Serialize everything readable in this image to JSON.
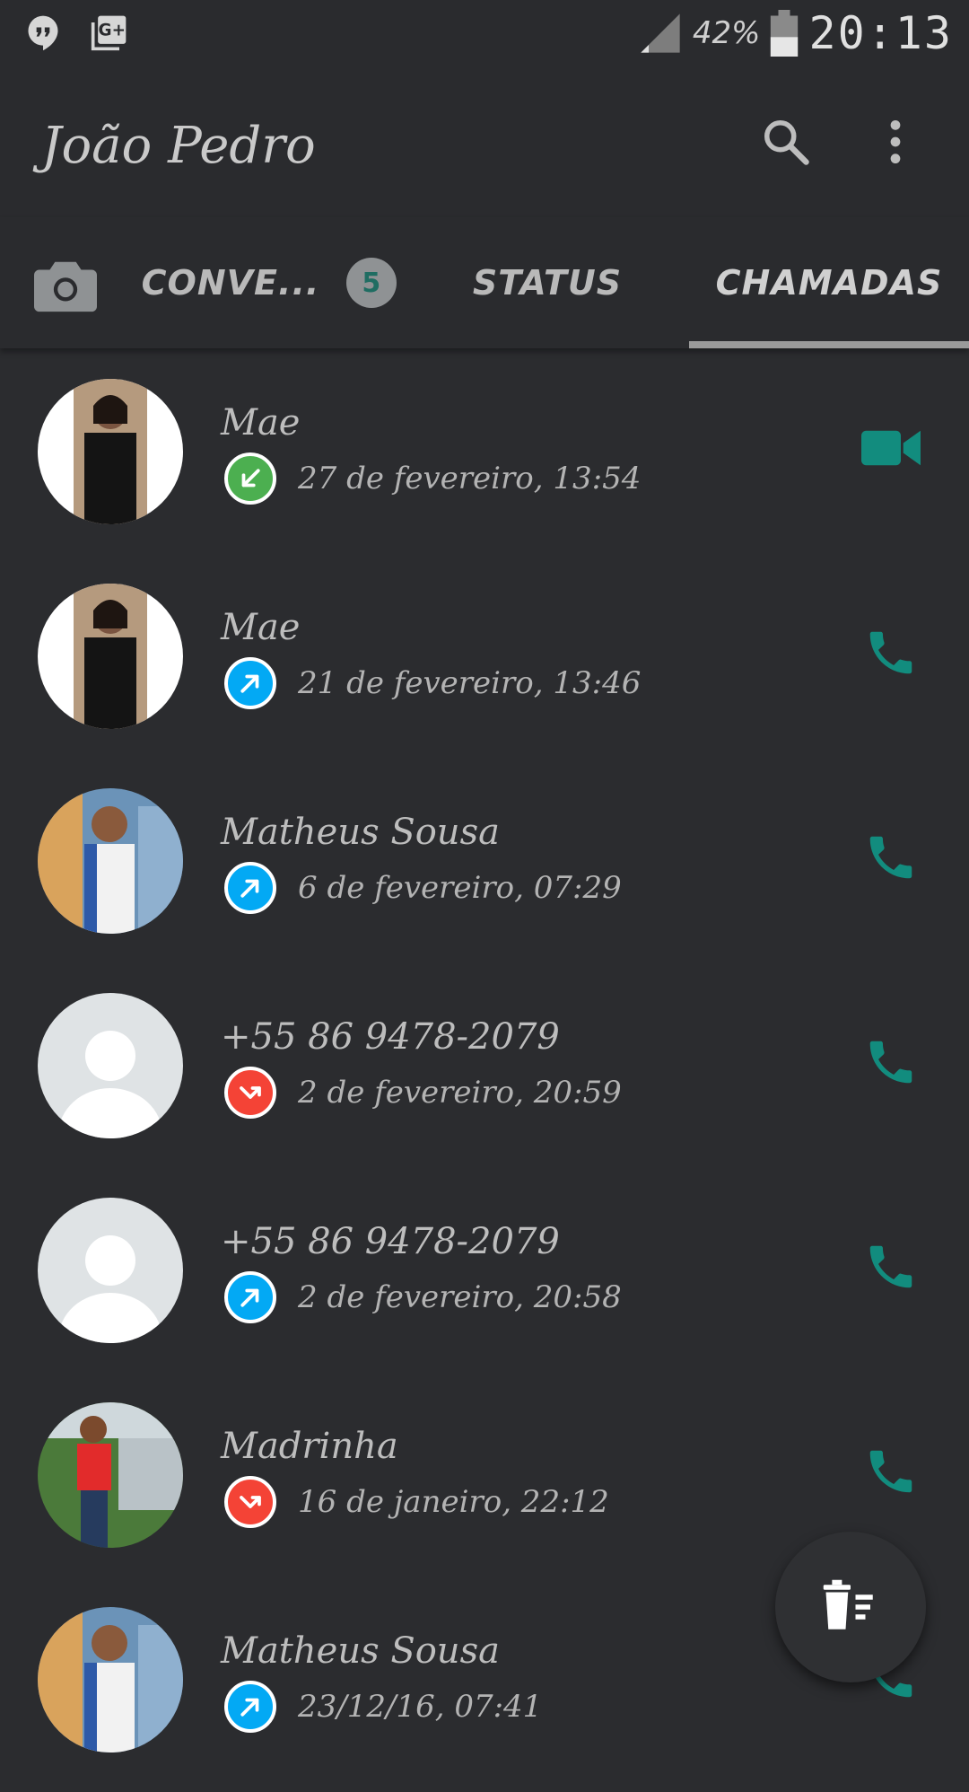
{
  "status_bar": {
    "battery": "42%",
    "time": "20:13"
  },
  "app_bar": {
    "title": "João Pedro"
  },
  "tabs": {
    "conversations": "CONVE...",
    "conversations_badge": "5",
    "status": "STATUS",
    "calls": "CHAMADAS"
  },
  "colors": {
    "accent": "#128c7e",
    "incoming": "#4caf50",
    "outgoing": "#03a9f4",
    "missed": "#f44336"
  },
  "calls": [
    {
      "name": "Mae",
      "when": "27 de fevereiro, 13:54",
      "direction": "incoming",
      "type": "video"
    },
    {
      "name": "Mae",
      "when": "21 de fevereiro, 13:46",
      "direction": "outgoing",
      "type": "voice"
    },
    {
      "name": "Matheus Sousa",
      "when": "6 de fevereiro, 07:29",
      "direction": "outgoing",
      "type": "voice"
    },
    {
      "name": "+55 86 9478-2079",
      "when": "2 de fevereiro, 20:59",
      "direction": "missed",
      "type": "voice"
    },
    {
      "name": "+55 86 9478-2079",
      "when": "2 de fevereiro, 20:58",
      "direction": "outgoing",
      "type": "voice"
    },
    {
      "name": "Madrinha",
      "when": "16 de janeiro, 22:12",
      "direction": "missed",
      "type": "voice"
    },
    {
      "name": "Matheus Sousa",
      "when": "23/12/16, 07:41",
      "direction": "outgoing",
      "type": "voice"
    }
  ]
}
